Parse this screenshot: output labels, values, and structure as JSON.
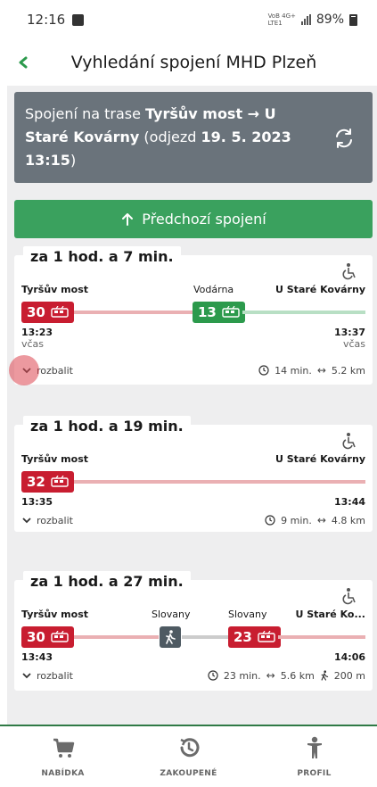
{
  "status_bar": {
    "time": "12:16",
    "network_top": "VoB 4G+",
    "network_bottom": "LTE1",
    "battery": "89%"
  },
  "app": {
    "title": "Vyhledání spojení MHD Plzeň",
    "accent_color": "#3aa15e"
  },
  "summary": {
    "prefix": "Spojení na trase ",
    "from": "Tyršův most",
    "arrow": " → ",
    "to": "U Staré Kovárny",
    "mid": " (odjezd ",
    "date": "19. 5. 2023",
    "time": "13:15",
    "suffix": ")"
  },
  "prev_button": {
    "label": "Předchozí spojení"
  },
  "connections": [
    {
      "eta": "za 1 hod. a 7 min.",
      "stops": [
        "Tyršův most",
        "Vodárna",
        "U Staré Kovárny"
      ],
      "lines": [
        {
          "number": "30",
          "color": "#c81d30"
        },
        {
          "number": "13",
          "color": "#2c9a4c"
        }
      ],
      "depart": "13:23",
      "arrive": "13:37",
      "depart_status": "včas",
      "arrive_status": "včas",
      "expand_label": "rozbalit",
      "duration": "14 min.",
      "distance": "5.2 km"
    },
    {
      "eta": "za 1 hod. a 19 min.",
      "stops": [
        "Tyršův most",
        "U Staré Kovárny"
      ],
      "lines": [
        {
          "number": "32",
          "color": "#c81d30"
        }
      ],
      "depart": "13:35",
      "arrive": "13:44",
      "expand_label": "rozbalit",
      "duration": "9 min.",
      "distance": "4.8 km"
    },
    {
      "eta": "za 1 hod. a 27 min.",
      "stops": [
        "Tyršův most",
        "Slovany",
        "Slovany",
        "U Staré Ko..."
      ],
      "lines": [
        {
          "number": "30",
          "color": "#c81d30"
        },
        {
          "number": "23",
          "color": "#c81d30"
        }
      ],
      "depart": "13:43",
      "arrive": "14:06",
      "expand_label": "rozbalit",
      "duration": "23 min.",
      "distance": "5.6 km",
      "walk": "200 m"
    }
  ],
  "bottom_nav": [
    {
      "label": "NABÍDKA",
      "icon": "cart-icon"
    },
    {
      "label": "ZAKOUPENÉ",
      "icon": "history-icon"
    },
    {
      "label": "PROFIL",
      "icon": "person-icon"
    }
  ]
}
